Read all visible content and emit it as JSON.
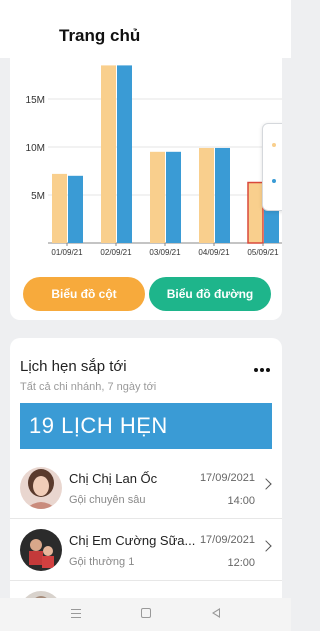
{
  "header": {
    "title": "Trang chủ"
  },
  "chart_data": {
    "type": "bar",
    "categories": [
      "01/09/21",
      "02/09/21",
      "03/09/21",
      "04/09/21",
      "05/09/21"
    ],
    "series": [
      {
        "values": [
          7.2,
          18.5,
          9.5,
          9.9,
          6.3
        ]
      },
      {
        "values": [
          7.0,
          18.5,
          9.5,
          9.9,
          6.1
        ]
      }
    ],
    "y_ticks": [
      "5M",
      "10M",
      "15M"
    ],
    "y_tick_values": [
      5,
      10,
      15
    ],
    "ylim": [
      0,
      20
    ],
    "grid": true,
    "colors": [
      "#f9cf8d",
      "#3a9bd5"
    ],
    "selected_index": 4,
    "selected_border_color": "#d9483b"
  },
  "chart_buttons": {
    "bar_label": "Biểu đồ cột",
    "line_label": "Biểu đồ đường"
  },
  "appointments": {
    "title": "Lịch hẹn sắp tới",
    "subtitle": "Tất cả chi nhánh, 7 ngày tới",
    "count_banner": "19 LỊCH HẸN",
    "items": [
      {
        "name": "Chị Chị Lan Ốc",
        "service": "Gội chuyên sâu",
        "date": "17/09/2021",
        "time": "14:00"
      },
      {
        "name": "Chị Em Cường Sữa...",
        "service": "Gội thường  1",
        "date": "17/09/2021",
        "time": "12:00"
      },
      {
        "name": "",
        "service": "",
        "date": "",
        "time": ""
      }
    ]
  },
  "icons": {
    "more": "more-horizontal-icon",
    "chevron": "chevron-right-icon",
    "nav_menu": "recent-apps-icon",
    "nav_home": "home-icon",
    "nav_back": "back-icon"
  }
}
